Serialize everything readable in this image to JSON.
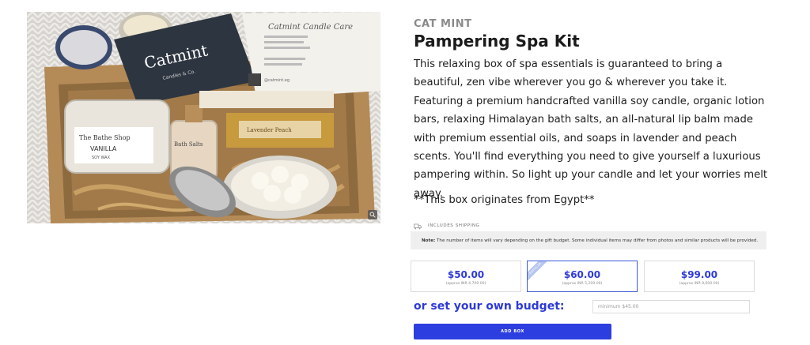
{
  "product": {
    "image_alt": "Cat Mint pampering spa kit box",
    "brand": "CAT MINT",
    "title": "Pampering Spa Kit",
    "description": "This relaxing box of spa essentials is guaranteed to bring a beautiful, zen vibe wherever you go & wherever you take it. Featuring a premium handcrafted vanilla soy candle, organic lotion bars, relaxing Himalayan bath salts, an all-natural lip balm made with premium essential oils, and soaps in lavender and peach scents. You'll find everything you need to give yourself a luxurious pampering within. So light up your candle and let your worries melt away.",
    "origin": "**This box originates from Egypt**"
  },
  "photo": {
    "card_brand": "Catmint",
    "card_sub": "Candles & Co.",
    "insert_heading": "Catmint Candle Care",
    "candle_label_1": "The Bathe Shop",
    "candle_label_2": "VANILLA",
    "candle_label_3": "SOY WAX",
    "salt_label": "Bath Salts",
    "soap_label": "Lavender Peach",
    "handle": "@catmint.eg"
  },
  "shipping": {
    "icon": "truck-icon",
    "label": "INCLUDES SHIPPING"
  },
  "note": {
    "prefix": "Note:",
    "text": " The number of items will vary depending on the gift budget. Some individual items may differ from photos and similar products will be provided."
  },
  "budget_options": [
    {
      "price": "$50.00",
      "approx": "(approx INR 4,700.00)",
      "selected": false
    },
    {
      "price": "$60.00",
      "approx": "(approx INR 5,200.00)",
      "selected": true,
      "badge": "POPULAR"
    },
    {
      "price": "$99.00",
      "approx": "(approx INR 8,600.00)",
      "selected": false
    }
  ],
  "custom_budget": {
    "label": "or set your own budget:",
    "placeholder": "minimum $45.00"
  },
  "actions": {
    "add_label": "ADD BOX"
  },
  "colors": {
    "accent": "#2d3ad8",
    "button": "#2d3ee0",
    "brand_gray": "#8b8b8b",
    "note_bg": "#efefef"
  }
}
